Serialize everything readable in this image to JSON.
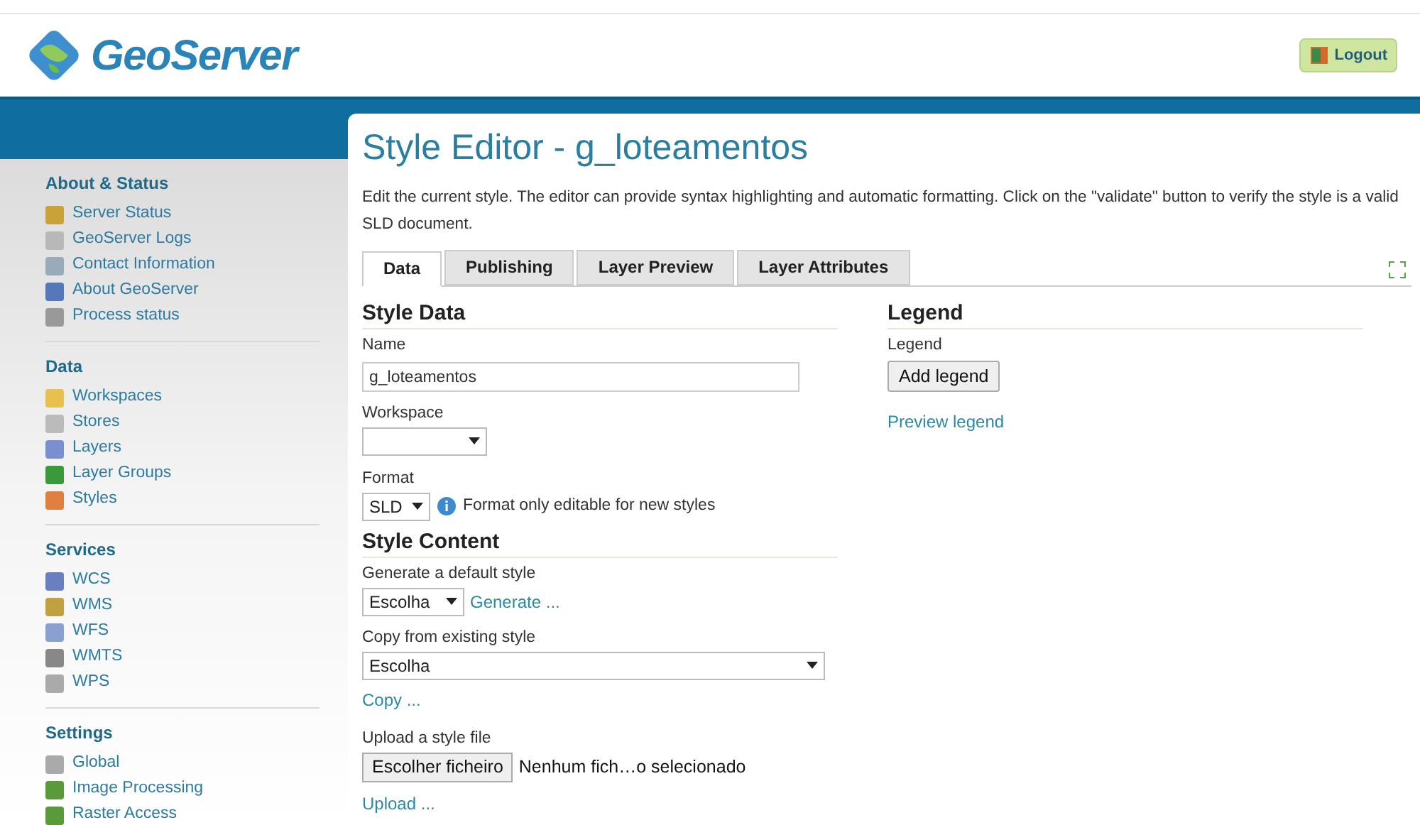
{
  "header": {
    "logo_text": "GeoServer",
    "logout": "Logout"
  },
  "sidebar": [
    {
      "title": "About & Status",
      "items": [
        "Server Status",
        "GeoServer Logs",
        "Contact Information",
        "About GeoServer",
        "Process status"
      ]
    },
    {
      "title": "Data",
      "items": [
        "Workspaces",
        "Stores",
        "Layers",
        "Layer Groups",
        "Styles"
      ]
    },
    {
      "title": "Services",
      "items": [
        "WCS",
        "WMS",
        "WFS",
        "WMTS",
        "WPS"
      ]
    },
    {
      "title": "Settings",
      "items": [
        "Global",
        "Image Processing",
        "Raster Access"
      ]
    }
  ],
  "page": {
    "title": "Style Editor - g_loteamentos",
    "description": "Edit the current style. The editor can provide syntax highlighting and automatic formatting. Click on the \"validate\" button to verify the style is a valid SLD document."
  },
  "tabs": [
    {
      "label": "Data",
      "selected": true
    },
    {
      "label": "Publishing",
      "selected": false
    },
    {
      "label": "Layer Preview",
      "selected": false
    },
    {
      "label": "Layer Attributes",
      "selected": false
    }
  ],
  "style_data": {
    "heading": "Style Data",
    "name_label": "Name",
    "name_value": "g_loteamentos",
    "workspace_label": "Workspace",
    "format_label": "Format",
    "format_value": "SLD",
    "format_note": "Format only editable for new styles"
  },
  "style_content": {
    "heading": "Style Content",
    "generate_label": "Generate a default style",
    "generate_value": "Escolha",
    "generate_link": "Generate ...",
    "copy_label": "Copy from existing style",
    "copy_value": "Escolha",
    "copy_link": "Copy ...",
    "upload_label": "Upload a style file",
    "file_button": "Escolher ficheiro",
    "file_status": "Nenhum fich…o selecionado",
    "upload_link": "Upload ..."
  },
  "legend": {
    "heading": "Legend",
    "label": "Legend",
    "button": "Add legend",
    "link": "Preview legend"
  }
}
